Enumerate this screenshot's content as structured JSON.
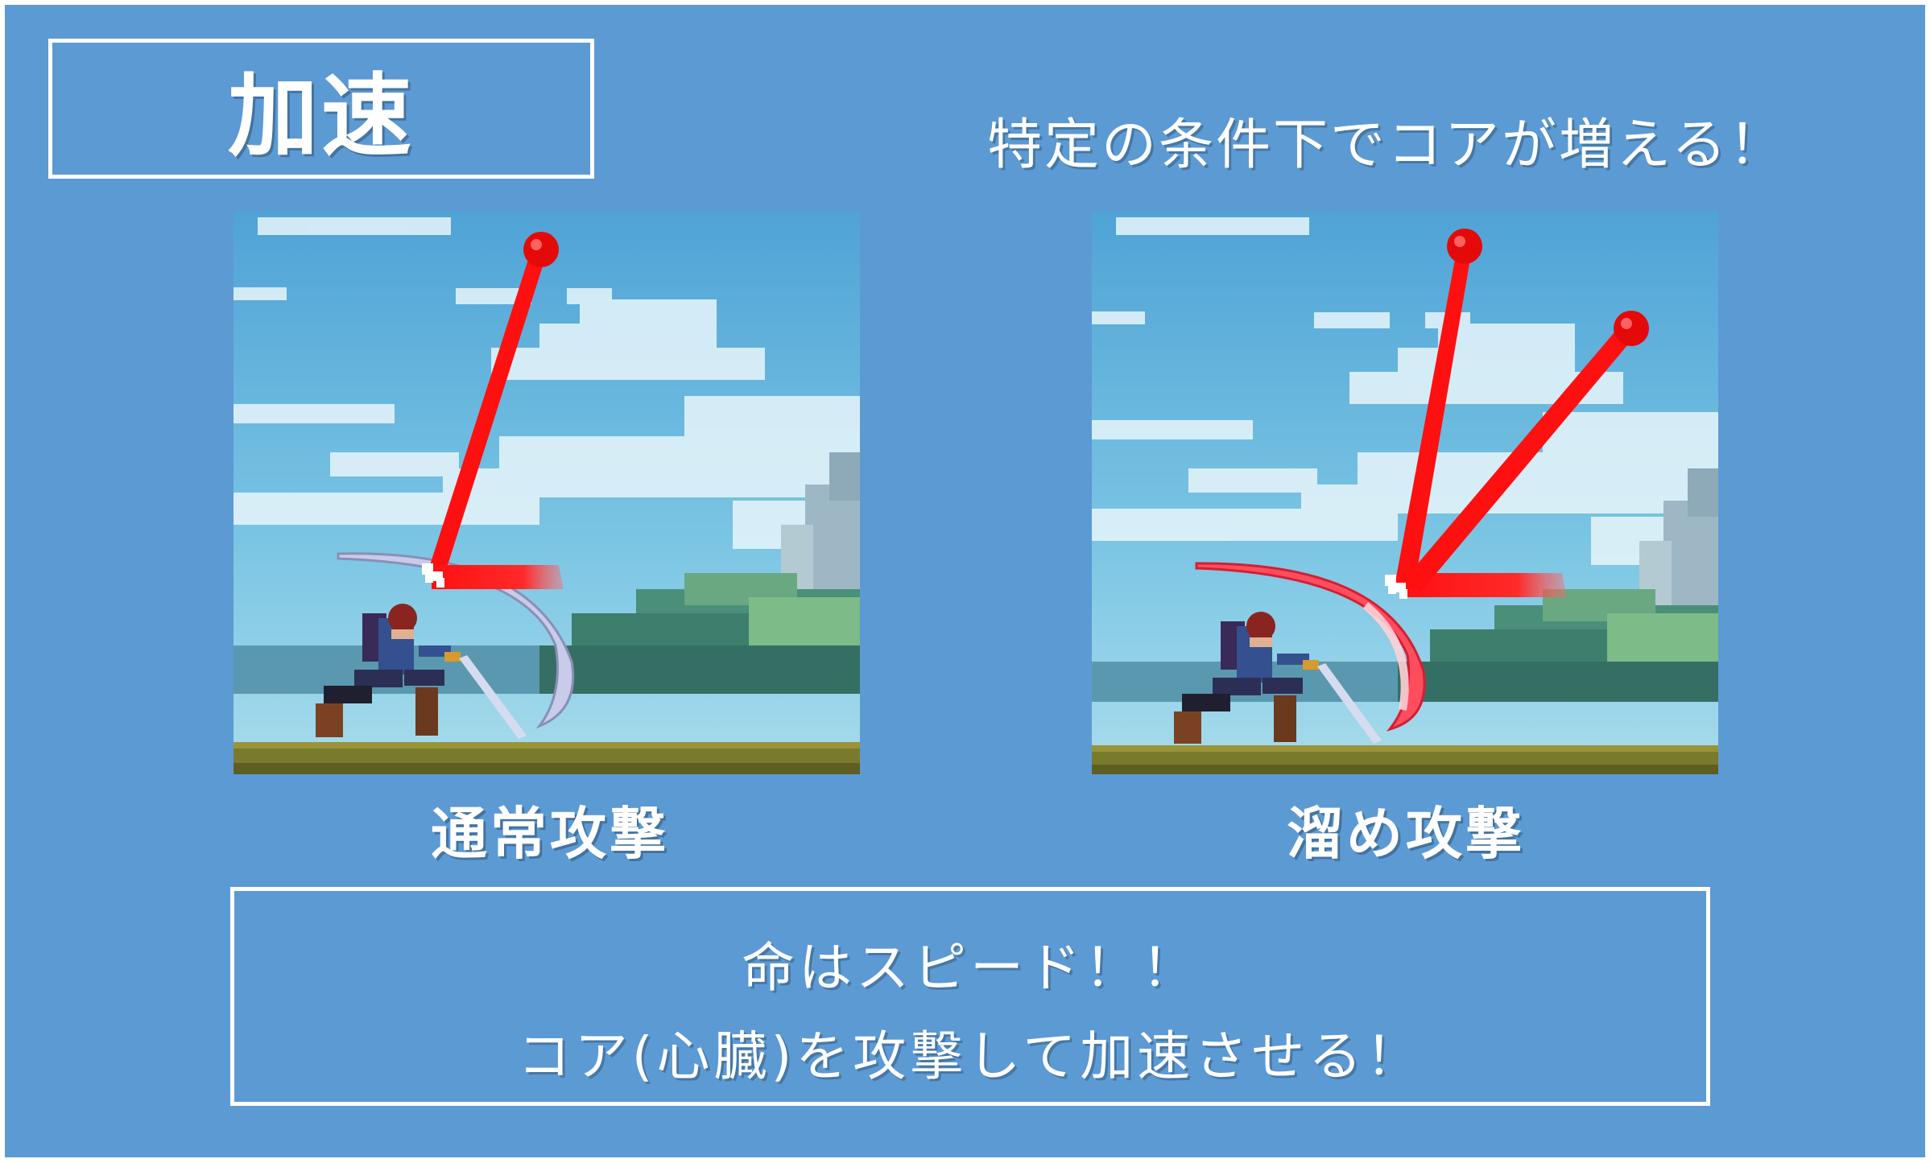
{
  "title": "加速",
  "tagline": "特定の条件下でコアが増える！",
  "panels": [
    {
      "caption": "通常攻撃"
    },
    {
      "caption": "溜め攻撃"
    }
  ],
  "bottom": {
    "line1": "命はスピード！！",
    "line2": "コア(心臓)を攻撃して加速させる！"
  },
  "colors": {
    "background": "#5c9ad4",
    "core_line": "#ff1010",
    "charged_slash": "#ff4d5e",
    "normal_slash": "#c9cce8"
  }
}
